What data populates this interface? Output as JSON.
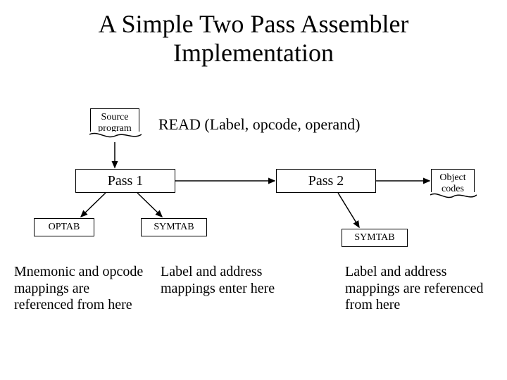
{
  "title_line1": "A Simple Two Pass Assembler",
  "title_line2": "Implementation",
  "source_doc": {
    "line1": "Source",
    "line2": "program"
  },
  "read_label": "READ (Label, opcode, operand)",
  "pass1": "Pass 1",
  "pass2": "Pass 2",
  "object_codes": {
    "line1": "Object",
    "line2": "codes"
  },
  "optab": "OPTAB",
  "symtab1": "SYMTAB",
  "symtab2": "SYMTAB",
  "note_optab": "Mnemonic and opcode mappings are referenced from here",
  "note_symtab_enter": "Label and address mappings enter here",
  "note_symtab_ref": "Label and address mappings are referenced from here"
}
